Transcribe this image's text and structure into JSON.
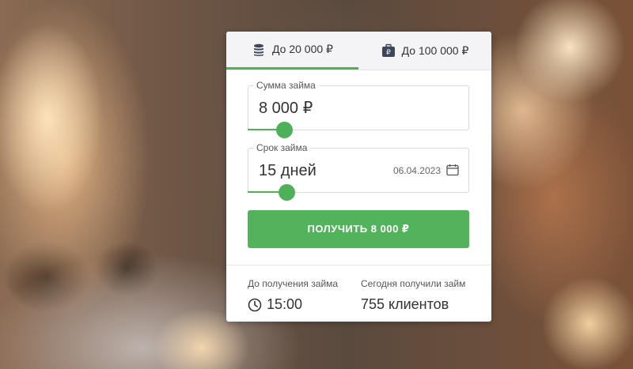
{
  "colors": {
    "accent": "#4fb05a",
    "button": "#52b35c"
  },
  "tabs": [
    {
      "label": "До 20 000 ₽",
      "icon": "coins-stack-icon",
      "active": true
    },
    {
      "label": "До 100 000 ₽",
      "icon": "briefcase-ruble-icon",
      "active": false
    }
  ],
  "loan_amount": {
    "legend": "Сумма займа",
    "value": "8 000 ₽",
    "slider_fraction": 0.16
  },
  "loan_term": {
    "legend": "Срок займа",
    "value": "15 дней",
    "due_date": "06.04.2023",
    "icon": "calendar-icon",
    "slider_fraction": 0.17
  },
  "cta": {
    "label": "ПОЛУЧИТЬ 8 000 ₽"
  },
  "stats": {
    "left": {
      "label": "До получения займа",
      "value": "15:00",
      "icon": "clock-icon"
    },
    "right": {
      "label": "Сегодня получили займ",
      "value": "755 клиентов"
    }
  }
}
